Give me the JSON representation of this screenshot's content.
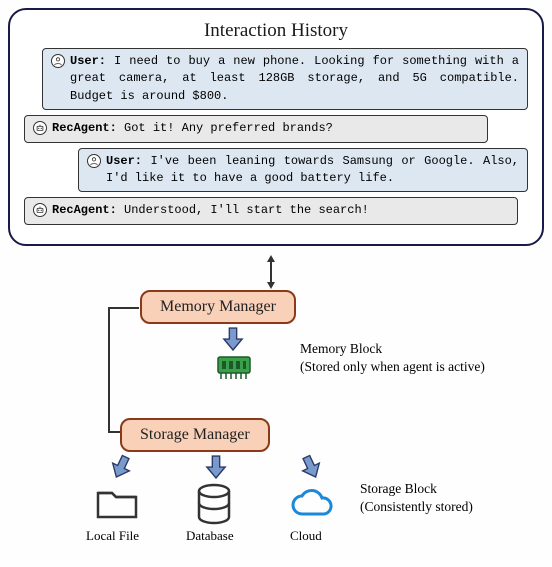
{
  "history": {
    "title": "Interaction History",
    "messages": [
      {
        "speaker": "User:",
        "text": "I need to buy a new phone. Looking for something with a great camera, at least 128GB storage, and 5G compatible. Budget is around $800."
      },
      {
        "speaker": "RecAgent:",
        "text": "Got it! Any preferred brands?"
      },
      {
        "speaker": "User:",
        "text": "I've been leaning towards Samsung or Google. Also, I'd like it to have a good battery life."
      },
      {
        "speaker": "RecAgent:",
        "text": "Understood, I'll start the search!"
      }
    ]
  },
  "memory_manager": {
    "label": "Memory Manager"
  },
  "memory_block": {
    "title": "Memory Block",
    "subtitle": "(Stored only when agent is active)"
  },
  "storage_manager": {
    "label": "Storage Manager"
  },
  "storage_targets": {
    "local_file": "Local File",
    "database": "Database",
    "cloud": "Cloud"
  },
  "storage_block": {
    "title": "Storage Block",
    "subtitle": "(Consistently stored)"
  }
}
